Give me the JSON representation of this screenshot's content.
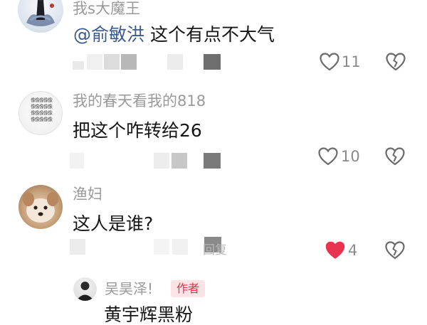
{
  "comments": [
    {
      "username": "我s大魔王",
      "mention": "@俞敏洪",
      "text": " 这个有点不大气",
      "likes": "11",
      "liked": false
    },
    {
      "username": "我的春天看我的818",
      "text": "把这个咋转给26",
      "likes": "10",
      "liked": false,
      "avatar_text": [
        "像像像像像",
        "像像像像像",
        "像像像像像",
        "像像像像像"
      ]
    },
    {
      "username": "渔妇",
      "text": "这人是谁?",
      "likes": "4",
      "liked": true,
      "reply_fragment": "回复"
    }
  ],
  "reply": {
    "username": "吴昊泽!",
    "badge": "作者",
    "text": "黄宇辉黑粉"
  },
  "colors": {
    "like_active": "#e8344e",
    "author_badge_bg": "#fbe3e6",
    "author_badge_text": "#e6324b"
  },
  "icons": [
    "heart-icon",
    "heart-filled-icon",
    "broken-heart-icon"
  ]
}
